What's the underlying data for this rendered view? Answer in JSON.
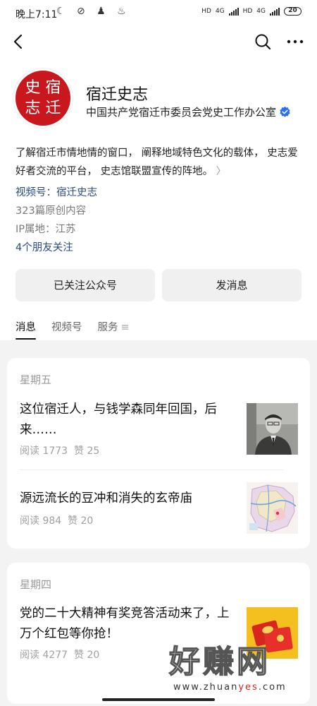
{
  "status_bar": {
    "time": "晚上7:11",
    "network_1": "4G",
    "network_2": "4G",
    "hd_1": "HD",
    "hd_2": "HD",
    "battery": "20"
  },
  "account": {
    "seal_chars": [
      "史",
      "宿",
      "志",
      "迁"
    ],
    "name": "宿迁史志",
    "organization": "中国共产党宿迁市委员会党史工作办公室",
    "description": "了解宿迁市情地情的窗口， 阐释地域特色文化的载体， 史志爱好者交流的平台， 史志馆联盟宣传的阵地。",
    "channel": "视频号：宿迁史志",
    "original_count": "323篇原创内容",
    "ip_location": "IP属地：江苏",
    "friends_following": "4个朋友关注"
  },
  "buttons": {
    "follow": "已关注公众号",
    "message": "发消息"
  },
  "tabs": [
    {
      "label": "消息",
      "active": true
    },
    {
      "label": "视频号",
      "active": false
    },
    {
      "label": "服务",
      "active": false
    }
  ],
  "groups": [
    {
      "day": "星期五",
      "articles": [
        {
          "title": "这位宿迁人，与钱学森同年回国，后来……",
          "reads": "阅读 1773",
          "likes": "赞 25",
          "thumb": "portrait-photo"
        },
        {
          "title": "源远流长的豆冲和消失的玄帝庙",
          "reads": "阅读 984",
          "likes": "赞 20",
          "thumb": "map-image"
        }
      ]
    },
    {
      "day": "星期四",
      "articles": [
        {
          "title": "党的二十大精神有奖竞答活动来了，上万个红包等你抢！",
          "reads": "阅读 4277",
          "likes": "赞 20",
          "thumb": "red-envelope-image"
        }
      ]
    }
  ],
  "watermark": {
    "text": "好赚网",
    "url_prefix": "www.zhuan",
    "url_highlight": "yes",
    "url_suffix": ".com"
  },
  "colors": {
    "accent_blue": "#2a4a7f",
    "seal_red": "#c8171d",
    "verified_blue": "#2b6df6"
  }
}
